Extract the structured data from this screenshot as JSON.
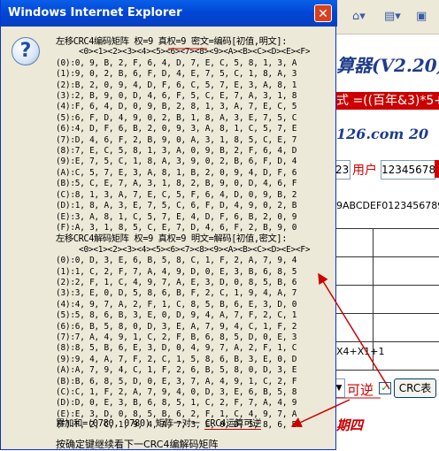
{
  "window": {
    "title": "Windows Internet Explorer",
    "close_glyph": "✕"
  },
  "dialog": {
    "icon": "question-icon",
    "encode_header": "左移CRC4编码矩阵 权=9 真权=9 密文=编码[初值,明文]:",
    "decode_header": "左移CRC4解码矩阵 权=9 真权=9 明文=解码[初值,密文]:",
    "col_header": "<0><1><2><3><4><5><6><7><8><9><A><B><C><D><E><F>",
    "encode_rows": [
      "(0):0, 9, B, 2, F, 6, 4, D, 7, E, C, 5, 8, 1, 3, A",
      "(1):9, 0, 2, B, 6, F, D, 4, E, 7, 5, C, 1, 8, A, 3",
      "(2):B, 2, 0, 9, 4, D, F, 6, C, 5, 7, E, 3, A, 8, 1",
      "(3):2, B, 9, 0, D, 4, 6, F, 5, C, E, 7, A, 3, 1, 8",
      "(4):F, 6, 4, D, 0, 9, B, 2, 8, 1, 3, A, 7, E, C, 5",
      "(5):6, F, D, 4, 9, 0, 2, B, 1, 8, A, 3, E, 7, 5, C",
      "(6):4, D, F, 6, B, 2, 0, 9, 3, A, 8, 1, C, 5, 7, E",
      "(7):D, 4, 6, F, 2, B, 9, 0, A, 3, 1, 8, 5, C, E, 7",
      "(8):7, E, C, 5, 8, 1, 3, A, 0, 9, B, 2, F, 6, 4, D",
      "(9):E, 7, 5, C, 1, 8, A, 3, 9, 0, 2, B, 6, F, D, 4",
      "(A):C, 5, 7, E, 3, A, 8, 1, B, 2, 0, 9, 4, D, F, 6",
      "(B):5, C, E, 7, A, 3, 1, 8, 2, B, 9, 0, D, 4, 6, F",
      "(C):8, 1, 3, A, 7, E, C, 5, F, 6, 4, D, 0, 9, B, 2",
      "(D):1, 8, A, 3, E, 7, 5, C, 6, F, D, 4, 9, 0, 2, B",
      "(E):3, A, 8, 1, C, 5, 7, E, 4, D, F, 6, B, 2, 0, 9",
      "(F):A, 3, 1, 8, 5, C, E, 7, D, 4, 6, F, 2, B, 9, 0"
    ],
    "decode_rows": [
      "(0):0, D, 3, E, 6, B, 5, 8, C, 1, F, 2, A, 7, 9, 4",
      "(1):1, C, 2, F, 7, A, 4, 9, D, 0, E, 3, B, 6, 8, 5",
      "(2):2, F, 1, C, 4, 9, 7, A, E, 3, D, 0, 8, 5, B, 6",
      "(3):3, E, 0, D, 5, 8, 6, B, F, 2, C, 1, 9, 4, A, 7",
      "(4):4, 9, 7, A, 2, F, 1, C, 8, 5, B, 6, E, 3, D, 0",
      "(5):5, 8, 6, B, 3, E, 0, D, 9, 4, A, 7, F, 2, C, 1",
      "(6):6, B, 5, 8, 0, D, 3, E, A, 7, 9, 4, C, 1, F, 2",
      "(7):7, A, 4, 9, 1, C, 2, F, B, 6, 8, 5, D, 0, E, 3",
      "(8):8, 5, B, 6, E, 3, D, 0, 4, 9, 7, A, 2, F, 1, C",
      "(9):9, 4, A, 7, F, 2, C, 1, 5, 8, 6, B, 3, E, 0, D",
      "(A):A, 7, 9, 4, C, 1, F, 2, 6, B, 5, 8, 0, D, 3, E",
      "(B):B, 6, 8, 5, D, 0, E, 3, 7, A, 4, 9, 1, C, 2, F",
      "(C):C, 1, F, 2, A, 7, 9, 4, 0, D, 3, E, 6, B, 5, 8",
      "(D):D, 0, E, 3, B, 6, 8, 5, 1, C, 2, F, 7, A, 4, 9",
      "(E):E, 3, D, 0, 8, 5, B, 6, 2, F, 1, C, 4, 9, 7, A",
      "(F):F, 2, C, 1, 9, 4, A, 7, 3, E, 0, D, 5, 8, 6, B"
    ],
    "sum_prefix": "累加和=(0780, 0780) 矩阵一对一",
    "sum_highlight": "CRC4运算可逆",
    "prompt": "按确定键继续看下一CRC4编解码矩阵"
  },
  "background": {
    "title": "算器(V2.20)",
    "formula": "式 =((百年&3)*5+",
    "url": "126.com    20",
    "input_a": "23",
    "user_label": "用户",
    "user_value": "12345678",
    "hex": "9ABCDEF0123456789",
    "poly": "X4+X1+1",
    "select_value": "▼",
    "reversible": "可逆",
    "crc_table_button": "CRC表",
    "period": "期四",
    "check_mark": "✓"
  }
}
